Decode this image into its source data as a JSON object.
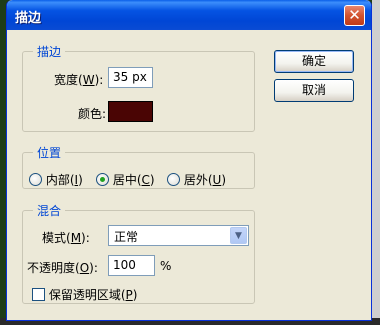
{
  "window": {
    "title": "描边",
    "close_glyph": "✕"
  },
  "stroke_group": {
    "title": "描边",
    "width_label": "宽度(",
    "width_key": "W",
    "width_label_end": "):",
    "width_value": "35 px",
    "color_label": "颜色:",
    "color_hex": "#4a0504"
  },
  "position_group": {
    "title": "位置",
    "options": [
      {
        "label": "内部(",
        "key": "I",
        "end": ")",
        "checked": false
      },
      {
        "label": "居中(",
        "key": "C",
        "end": ")",
        "checked": true
      },
      {
        "label": "居外(",
        "key": "U",
        "end": ")",
        "checked": false
      }
    ]
  },
  "blend_group": {
    "title": "混合",
    "mode_label": "模式(",
    "mode_key": "M",
    "mode_label_end": "):",
    "mode_value": "正常",
    "opacity_label": "不透明度(",
    "opacity_key": "O",
    "opacity_label_end": "):",
    "opacity_value": "100",
    "opacity_unit": "%",
    "preserve_label": "保留透明区域(",
    "preserve_key": "P",
    "preserve_label_end": ")"
  },
  "buttons": {
    "ok": "确定",
    "cancel": "取消"
  }
}
